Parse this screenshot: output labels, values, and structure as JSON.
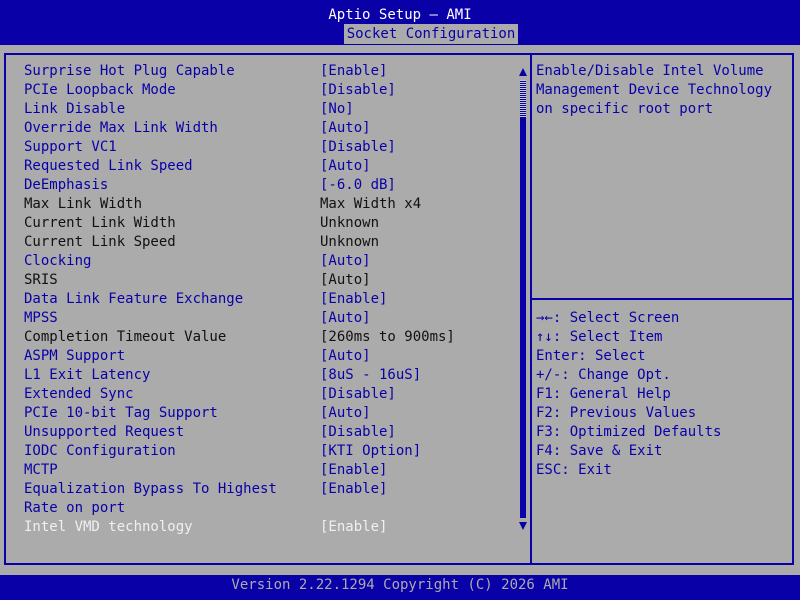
{
  "header": {
    "title": "Aptio Setup – AMI",
    "active_tab": "Socket Configuration"
  },
  "settings": [
    {
      "label": "Surprise Hot Plug Capable",
      "value": "[Enable]",
      "editable": true
    },
    {
      "label": "PCIe Loopback Mode",
      "value": "[Disable]",
      "editable": true
    },
    {
      "label": "Link Disable",
      "value": "[No]",
      "editable": true
    },
    {
      "label": "Override Max Link Width",
      "value": "[Auto]",
      "editable": true
    },
    {
      "label": "Support VC1",
      "value": "[Disable]",
      "editable": true
    },
    {
      "label": "Requested Link Speed",
      "value": "[Auto]",
      "editable": true
    },
    {
      "label": "DeEmphasis",
      "value": "[-6.0 dB]",
      "editable": true
    },
    {
      "label": "Max Link Width",
      "value": "Max Width x4",
      "editable": false
    },
    {
      "label": "Current Link Width",
      "value": "Unknown",
      "editable": false
    },
    {
      "label": "Current Link Speed",
      "value": "Unknown",
      "editable": false
    },
    {
      "label": "Clocking",
      "value": "[Auto]",
      "editable": true
    },
    {
      "label": "SRIS",
      "value": "[Auto]",
      "editable": false
    },
    {
      "label": "Data Link Feature Exchange",
      "value": "[Enable]",
      "editable": true
    },
    {
      "label": "MPSS",
      "value": "[Auto]",
      "editable": true
    },
    {
      "label": "Completion Timeout Value",
      "value": "[260ms to 900ms]",
      "editable": false
    },
    {
      "label": "ASPM Support",
      "value": "[Auto]",
      "editable": true
    },
    {
      "label": "L1 Exit Latency",
      "value": "[8uS - 16uS]",
      "editable": true
    },
    {
      "label": "Extended Sync",
      "value": "[Disable]",
      "editable": true
    },
    {
      "label": "PCIe 10-bit Tag Support",
      "value": "[Auto]",
      "editable": true
    },
    {
      "label": "Unsupported Request",
      "value": "[Disable]",
      "editable": true
    },
    {
      "label": "IODC Configuration",
      "value": "[KTI Option]",
      "editable": true
    },
    {
      "label": "MCTP",
      "value": "[Enable]",
      "editable": true
    },
    {
      "label": "Equalization Bypass To Highest",
      "value": "[Enable]",
      "editable": true
    },
    {
      "label": "Rate on port",
      "value": "",
      "editable": true
    },
    {
      "label": "Intel VMD technology",
      "value": "[Enable]",
      "editable": true,
      "selected": true
    }
  ],
  "help": {
    "lines": [
      "Enable/Disable Intel Volume",
      "Management Device Technology",
      "on specific root port"
    ]
  },
  "keys": [
    "→←: Select Screen",
    "↑↓: Select Item",
    "Enter: Select",
    "+/-: Change Opt.",
    "F1: General Help",
    "F2: Previous Values",
    "F3: Optimized Defaults",
    "F4: Save & Exit",
    "ESC: Exit"
  ],
  "footer": {
    "text": "Version 2.22.1294 Copyright (C) 2026 AMI"
  },
  "colors": {
    "background": "#ababab",
    "accent": "#0a00a8",
    "selected_text": "#f0f0f0",
    "readonly_text": "#111111"
  }
}
